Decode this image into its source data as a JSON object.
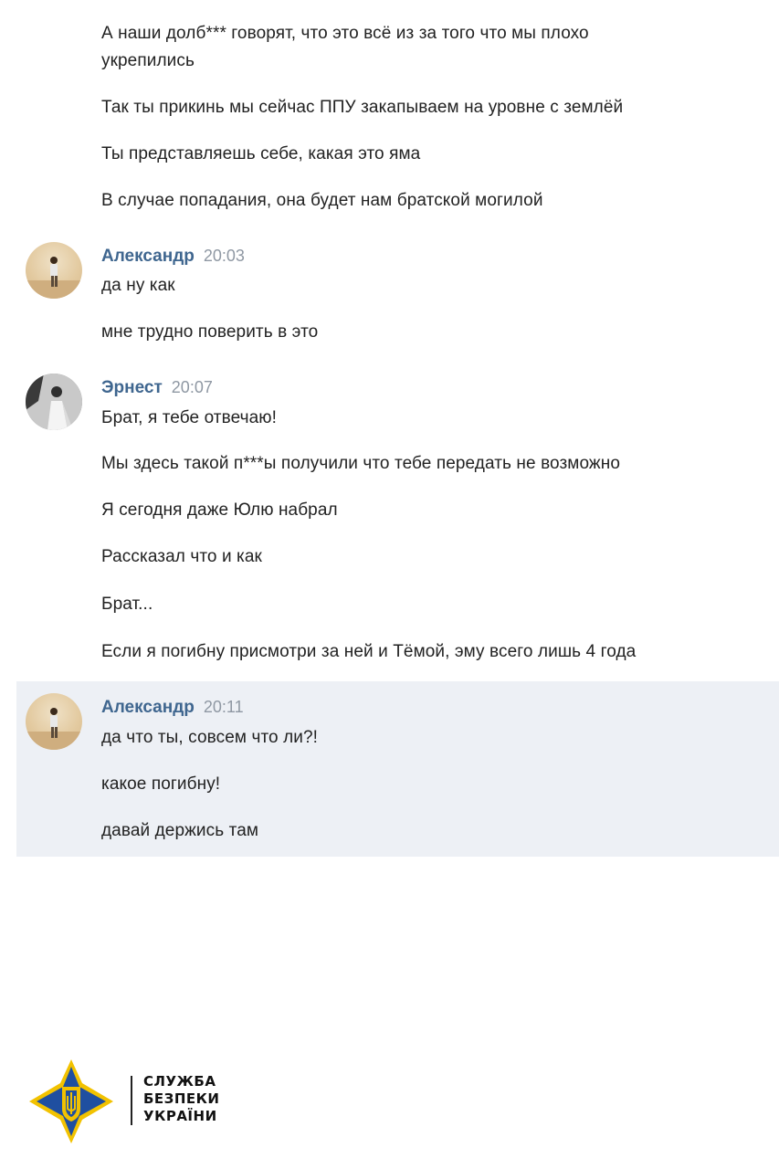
{
  "messages_top": [
    "А наши долб*** говорят, что это всё из за того что мы плохо",
    "укрепились",
    "Так ты прикинь мы сейчас ППУ закапываем на уровне с землёй",
    "Ты представляешь себе, какая это яма",
    "В случае попадания, она будет нам братской могилой"
  ],
  "groups": [
    {
      "author": "Александр",
      "time": "20:03",
      "messages": [
        "да ну как",
        "мне трудно поверить в это"
      ]
    },
    {
      "author": "Эрнест",
      "time": "20:07",
      "messages": [
        "Брат, я тебе отвечаю!",
        "Мы здесь такой п***ы получили что тебе передать не возможно",
        "Я сегодня даже Юлю набрал",
        "Рассказал что и как",
        "Брат...",
        "Если я погибну присмотри за ней и Тёмой, эму всего лишь 4 года"
      ]
    },
    {
      "author": "Александр",
      "time": "20:11",
      "messages": [
        "да что ты, совсем что ли?!",
        "какое погибну!",
        "давай держись там"
      ]
    }
  ],
  "footer": {
    "logo_lines": [
      "СЛУЖБА",
      "БЕЗПЕКИ",
      "УКРАЇНИ"
    ],
    "logo_colors": {
      "blue": "#1f4fa0",
      "gold": "#f2c200"
    }
  },
  "colors": {
    "author_name": "#3f668f",
    "timestamp": "#8f98a3",
    "highlight_bg": "#edf0f5"
  }
}
